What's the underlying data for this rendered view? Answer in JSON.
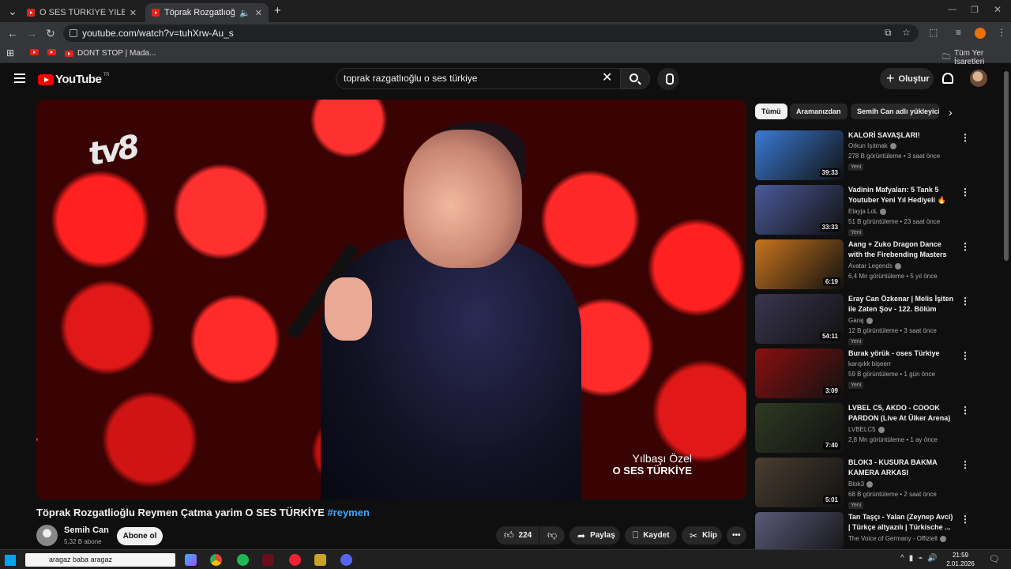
{
  "browser": {
    "tabs": [
      {
        "title": "O SES TÜRKİYE YILBAŞI ÖZEL -",
        "active": false
      },
      {
        "title": "Töprak Rozgatlıoğlu Reyme",
        "active": true
      }
    ],
    "url": "youtube.com/watch?v=tuhXrw-Au_s",
    "bookmarks": [
      {
        "label": "DONT STOP | Mada..."
      }
    ],
    "all_bookmarks": "Tüm Yer İşaretleri"
  },
  "header": {
    "logo": "YouTube",
    "country": "TR",
    "search_value": "toprak razgatlıoğlu o ses türkiye",
    "create_label": "Oluştur"
  },
  "player": {
    "channel_logo": "tv8",
    "overlay_line1": "Yılbaşı Özel",
    "overlay_line2": "O SES TÜRKİYE"
  },
  "video": {
    "title": "Töprak Rozgatlioğlu Reymen Çatma yarim O SES TÜRKİYE",
    "hashtag": "#reymen",
    "channel": "Semih Can",
    "subscribers": "5,32 B abone",
    "subscribe_label": "Abone ol",
    "likes": "224",
    "share_label": "Paylaş",
    "save_label": "Kaydet",
    "clip_label": "Klip"
  },
  "chips": [
    "Tümü",
    "Aramanızdan",
    "Semih Can adlı yükleyici"
  ],
  "recommendations": [
    {
      "title": "KALORİ SAVAŞLARI!",
      "channel": "Orkun Işıtmak",
      "meta": "278 B görüntüleme • 3 saat önce",
      "badge": "Yeni",
      "duration": "39:33",
      "verified": true,
      "color": "#3a7bd5"
    },
    {
      "title": "Vadinin Mafyaları: 5 Tank 5 Youtuber Yeni Yıl  Hediyeli 🔥",
      "channel": "Elayja LoL",
      "meta": "51 B görüntüleme • 23 saat önce",
      "badge": "Yeni",
      "duration": "33:33",
      "verified": true,
      "color": "#4b5a9c"
    },
    {
      "title": "Aang + Zuko Dragon Dance with the Firebending Masters 🐉 | ...",
      "channel": "Avatar Legends",
      "meta": "6,4 Mn görüntüleme • 5 yıl önce",
      "badge": "",
      "duration": "6:19",
      "verified": true,
      "color": "#c8741e"
    },
    {
      "title": "Eray Can Özkenar | Melis İşiten ile Zaten Şov - 122. Bölüm",
      "channel": "Garaj",
      "meta": "12 B görüntüleme • 3 saat önce",
      "badge": "Yeni",
      "duration": "54:11",
      "verified": true,
      "color": "#3b3550"
    },
    {
      "title": "Burak yörük - oses Türkiye",
      "channel": "karışıkk bişeerr",
      "meta": "59 B görüntüleme • 1 gün önce",
      "badge": "Yeni",
      "duration": "3:09",
      "verified": false,
      "color": "#8a1010"
    },
    {
      "title": "LVBEL C5, AKDO - COOOK PARDON (Live At Ülker Arena)",
      "channel": "LVBELC5",
      "meta": "2,8 Mn görüntüleme • 1 ay önce",
      "badge": "",
      "duration": "7:40",
      "verified": true,
      "color": "#2f3a22"
    },
    {
      "title": "BLOK3 - KUSURA BAKMA KAMERA ARKASI",
      "channel": "Blok3",
      "meta": "68 B görüntüleme • 2 saat önce",
      "badge": "Yeni",
      "duration": "5:01",
      "verified": true,
      "color": "#4a3e30"
    },
    {
      "title": "Tan Taşçı - Yalan (Zeynep Avci) | Türkçe altyazılı | Türkische ...",
      "channel": "The Voice of Germany - Offiziell",
      "meta": "",
      "badge": "",
      "duration": "",
      "verified": true,
      "color": "#5a5a7a"
    }
  ],
  "taskbar": {
    "search_text": "aragaz baba aragaz",
    "time": "21:59",
    "date": "2.01.2026"
  }
}
